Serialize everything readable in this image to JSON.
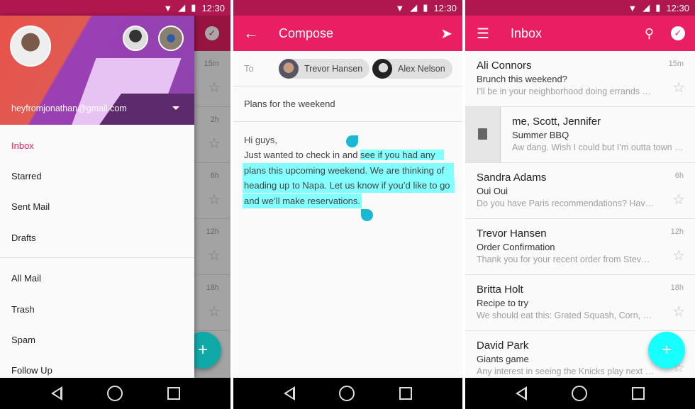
{
  "status": {
    "time": "12:30"
  },
  "drawer": {
    "account_email": "heyfromjonathan@gmail.com",
    "items": [
      {
        "label": "Inbox",
        "active": true
      },
      {
        "label": "Starred"
      },
      {
        "label": "Sent Mail"
      },
      {
        "label": "Drafts"
      },
      {
        "label": "All Mail"
      },
      {
        "label": "Trash"
      },
      {
        "label": "Spam"
      },
      {
        "label": "Follow Up"
      }
    ],
    "behind_times": [
      "15m",
      "2h",
      "6h",
      "12h",
      "18h"
    ]
  },
  "compose": {
    "title": "Compose",
    "to_label": "To",
    "recipients": [
      "Trevor Hansen",
      "Alex Nelson"
    ],
    "subject": "Plans for the weekend",
    "body": {
      "line1": "Hi guys,",
      "line2_plain": "Just wanted to check in and ",
      "line2_selected": "see if you had any",
      "line3_selected": "plans this upcoming weekend. We are thinking of",
      "line4_selected": "heading up to Napa. Let us know if you’d like to go",
      "line5_selected": "and we’ll make reservations."
    }
  },
  "inbox": {
    "title": "Inbox",
    "emails": [
      {
        "sender": "Ali Connors",
        "subject": "Brunch this weekend?",
        "preview": "I’ll be in your neighborhood doing errands …",
        "time": "15m"
      },
      {
        "sender": "me, Scott, Jennifer",
        "subject": "Summer BBQ",
        "preview": "Aw dang. Wish I could but I’m outta town …",
        "swiped": true
      },
      {
        "sender": "Sandra Adams",
        "subject": "Oui Oui",
        "preview": "Do you have Paris recommendations? Hav…",
        "time": "6h"
      },
      {
        "sender": "Trevor Hansen",
        "subject": "Order Confirmation",
        "preview": "Thank you for your recent order from Stev…",
        "time": "12h"
      },
      {
        "sender": "Britta Holt",
        "subject": "Recipe to try",
        "preview": "We should eat this: Grated Squash, Corn, …",
        "time": "18h"
      },
      {
        "sender": "David Park",
        "subject": "Giants game",
        "preview": "Any interest in seeing the Knicks play next …"
      }
    ]
  },
  "colors": {
    "primary": "#e91e63",
    "status": "#b0174f",
    "fab": "#18ffff",
    "selection": "#84ffff"
  }
}
